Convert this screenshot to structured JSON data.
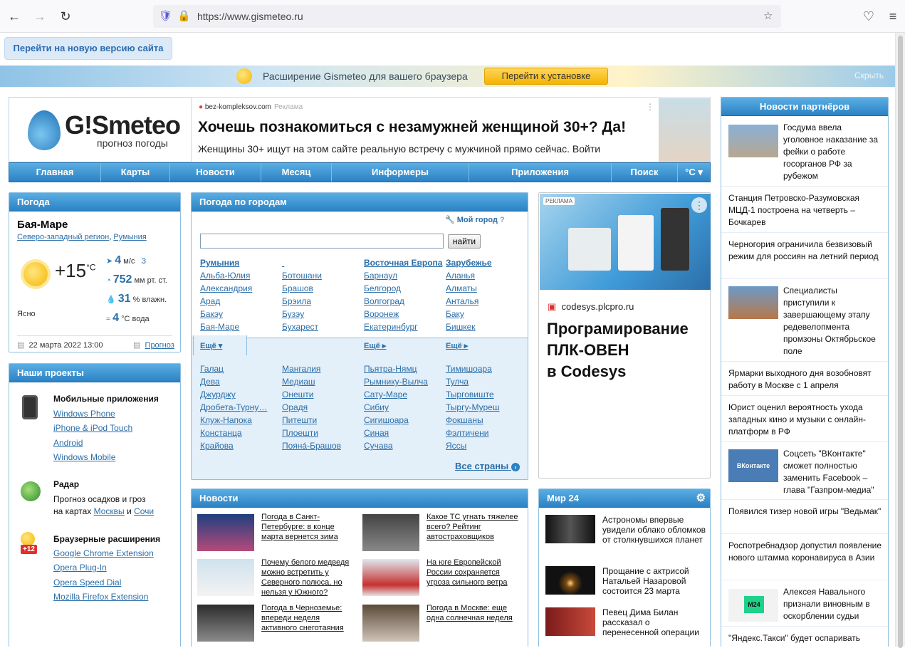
{
  "browser": {
    "url": "https://www.gismeteo.ru"
  },
  "top": {
    "new_version": "Перейти на новую версию сайта",
    "ext_text": "Расширение Gismeteo для вашего браузера",
    "ext_button": "Перейти к установке",
    "ext_hide": "Скрыть"
  },
  "logo": {
    "brand_a": "G!S",
    "brand_b": "meteo",
    "subtitle": "прогноз погоды"
  },
  "ad_top": {
    "source": "bez-kompleksov.com",
    "ad_label": "Реклама",
    "title": "Хочешь познакомиться с незамужней женщиной 30+? Да!",
    "text": "Женщины 30+ ищут на этом сайте реальную встречу с мужчиной прямо сейчас. Войти"
  },
  "nav": [
    "Главная",
    "Карты",
    "Новости",
    "Месяц",
    "Информеры",
    "Приложения",
    "Поиск",
    "°C ▾"
  ],
  "weather": {
    "header": "Погода",
    "city": "Бая-Маре",
    "region": "Северо-западный регион",
    "region_sep": ",",
    "country": "Румыния",
    "temp": "+15",
    "temp_unit": "°C",
    "condition": "Ясно",
    "wind_val": "4",
    "wind_unit": "м/с",
    "wind_dir": "З",
    "pressure_val": "752",
    "pressure_unit": "мм рт. ст.",
    "humidity_val": "31",
    "humidity_unit": "% влажн.",
    "water_val": "4",
    "water_unit": "°С вода",
    "date": "22 марта 2022 13:00",
    "forecast_link": "Прогноз"
  },
  "projects": {
    "header": "Наши проекты",
    "mobile_title": "Мобильные приложения",
    "mobile_links": [
      "Windows Phone",
      "iPhone & iPod Touch",
      "Android",
      "Windows Mobile"
    ],
    "radar_title": "Радар",
    "radar_text_1": "Прогноз осадков и гроз",
    "radar_text_2": "на картах",
    "radar_link_1": "Москвы",
    "radar_and": "и",
    "radar_link_2": "Сочи",
    "ext_title": "Браузерные расширения",
    "ext_badge": "+12",
    "ext_links": [
      "Google Chrome Extension",
      "Opera Plug-In",
      "Opera Speed Dial",
      "Mozilla Firefox Extension"
    ]
  },
  "cities": {
    "header": "Погода по городам",
    "my_city": "Мой город",
    "search_button": "найти",
    "col1": [
      "Румыния",
      "Альба-Юлия",
      "Александрия",
      "Арад",
      "Бакэу",
      "Бая-Маре"
    ],
    "col2": [
      "",
      "Ботошани",
      "Брашов",
      "Брэила",
      "Бузэу",
      "Бухарест"
    ],
    "col3": [
      "Восточная Европа",
      "Барнаул",
      "Белгород",
      "Волгоград",
      "Воронеж",
      "Екатеринбург"
    ],
    "col4": [
      "Зарубежье",
      "Аланья",
      "Алматы",
      "Анталья",
      "Баку",
      "Бишкек"
    ],
    "more_open": "Ещё",
    "more_1": "Ещё",
    "more_2": "Ещё",
    "more_col1": [
      "Галац",
      "Дева",
      "Джурджу",
      "Дробета-Турну…",
      "Клуж-Напока",
      "Констанца",
      "Крайова"
    ],
    "more_col2": [
      "Мангалия",
      "Медиаш",
      "Онешти",
      "Орадя",
      "Питешти",
      "Плоешти",
      "Поянá-Брашов"
    ],
    "more_col3": [
      "Пьятра-Нямц",
      "Рымнику-Вылча",
      "Сату-Маре",
      "Сибиу",
      "Сигишоара",
      "Синая",
      "Сучава"
    ],
    "more_col4": [
      "Тимишоара",
      "Тулча",
      "Тырговиште",
      "Тыргу-Муреш",
      "Фокшаны",
      "Фэлтичени",
      "Яссы"
    ],
    "all_countries": "Все страны"
  },
  "ad_mid": {
    "label": "РЕКЛАМА",
    "source": "codesys.plcpro.ru",
    "title_1": "Програмирование",
    "title_2": "ПЛК-ОВЕН",
    "title_3": "в Codesys"
  },
  "news": {
    "header": "Новости",
    "items": [
      "Погода в Санкт-Петербурге: в конце марта вернется зима",
      "Какое ТС угнать тяжелее всего? Рейтинг автостраховщиков",
      "Почему белого медведя можно встретить у Северного полюса, но нельзя у Южного?",
      "На юге Европейской России сохраняется угроза сильного ветра",
      "Погода в Черноземье: впереди неделя активного снеготаяния",
      "Погода в Москве: еще одна солнечная неделя"
    ]
  },
  "mir24": {
    "header": "Мир 24",
    "items": [
      "Астрономы впервые увидели облако обломков от столкнувшихся планет",
      "Прощание с актрисой Натальей Назаровой состоится 23 марта",
      "Певец Дима Билан рассказал о перенесенной операции"
    ]
  },
  "partners": {
    "header": "Новости партнёров",
    "items": [
      "Госдума ввела уголовное наказание за фейки о работе госорганов РФ за рубежом",
      "Станция Петровско-Разумовская МЦД-1 построена на четверть – Бочкарев",
      "Черногория ограничила безвизовый режим для россиян на летний период",
      "Специалисты приступили к завершающему этапу редевелопмента промзоны Октябрьское поле",
      "Ярмарки выходного дня возобновят работу в Москве с 1 апреля",
      "Юрист оценил вероятность ухода западных кино и музыки с онлайн-платформ в РФ",
      "Соцсеть \"ВКонтакте\" сможет полностью заменить Facebook – глава \"Газпром-медиа\"",
      "Появился тизер новой игры \"Ведьмак\"",
      "Роспотребнадзор допустил появление нового штамма коронавируса в Азии",
      "Алексея Навального признали виновным в оскорблении судьи",
      "\"Яндекс.Такси\" будет оспаривать"
    ],
    "thumb_m24": "M24",
    "thumb_vk": "ВКонтакте"
  }
}
